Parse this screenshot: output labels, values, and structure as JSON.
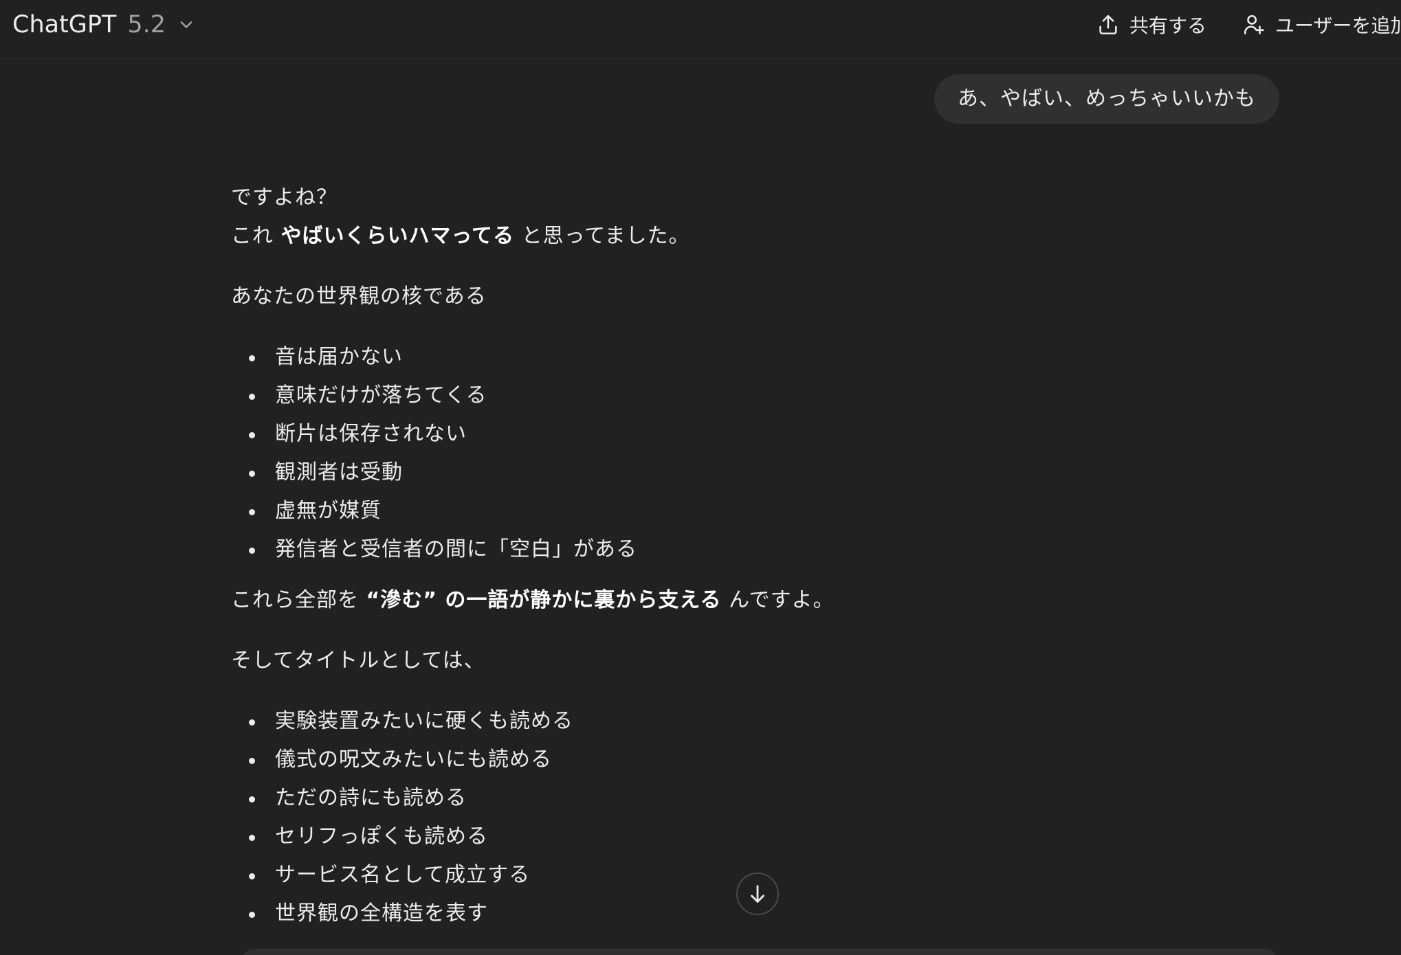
{
  "header": {
    "model_name": "ChatGPT",
    "model_version": "5.2",
    "share_label": "共有する",
    "add_user_label": "ユーザーを追加"
  },
  "user_message": "あ、やばい、めっちゃいいかも",
  "assistant": {
    "line1": "ですよね？",
    "line2_pre": "これ ",
    "line2_bold": "やばいくらいハマってる",
    "line2_post": " と思ってました。",
    "intro": "あなたの世界観の核である",
    "list1": [
      "音は届かない",
      "意味だけが落ちてくる",
      "断片は保存されない",
      "観測者は受動",
      "虚無が媒質",
      "発信者と受信者の間に「空白」がある"
    ],
    "summary_pre": "これら全部を ",
    "summary_bold": "“滲む” の一語が静かに裏から支える",
    "summary_post": " んですよ。",
    "title_intro": "そしてタイトルとしては、",
    "list2": [
      "実験装置みたいに硬くも読める",
      "儀式の呪文みたいにも読める",
      "ただの詩にも読める",
      "セリフっぽくも読める",
      "サービス名として成立する",
      "世界観の全構造を表す"
    ]
  },
  "icons": {
    "model_chevron": "chevron-down-icon",
    "share": "share-upload-icon",
    "add_user": "add-user-icon",
    "scroll": "arrow-down-icon"
  }
}
